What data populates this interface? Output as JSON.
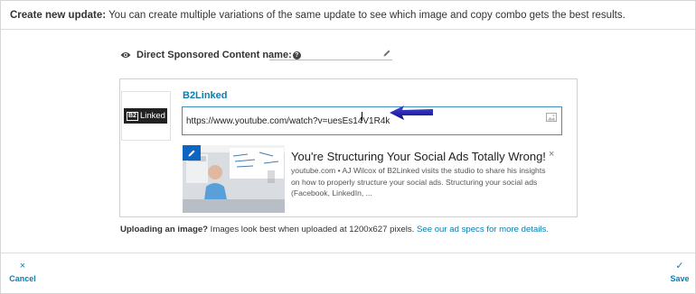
{
  "header": {
    "prefix": "Create new update:",
    "text": " You can create multiple variations of the same update to see which image and copy combo gets the best results."
  },
  "name_field": {
    "icon": "eye-icon",
    "label": "Direct Sponsored Content name:",
    "help_icon": "question-circle-icon",
    "help_glyph": "?",
    "value": "",
    "edit_icon": "pencil-icon"
  },
  "logo": {
    "badge": "B2",
    "word": "Linked"
  },
  "company_name": "B2Linked",
  "url_input": {
    "value": "https://www.youtube.com/watch?v=uesEs14V1R4k",
    "image_icon": "image-icon"
  },
  "preview": {
    "edit_icon": "pencil-icon",
    "title": "You're Structuring Your Social Ads Totally Wrong!",
    "source": "youtube.com",
    "separator": " • ",
    "description": "AJ Wilcox of B2Linked visits the studio to share his insights on how to properly structure your social ads. Structuring your social ads (Facebook, LinkedIn, ...",
    "close_glyph": "×"
  },
  "upload_note": {
    "bold": "Uploading an image?",
    "text": " Images look best when uploaded at 1200x627 pixels. ",
    "link": "See our ad specs for more details."
  },
  "footer": {
    "cancel_glyph": "×",
    "cancel_label": "Cancel",
    "save_glyph": "✓",
    "save_label": "Save"
  },
  "colors": {
    "link": "#0a7eb0",
    "input_border": "#3a8fc5",
    "annotation_arrow": "#1a1aa8",
    "edit_badge": "#0a66c2"
  }
}
